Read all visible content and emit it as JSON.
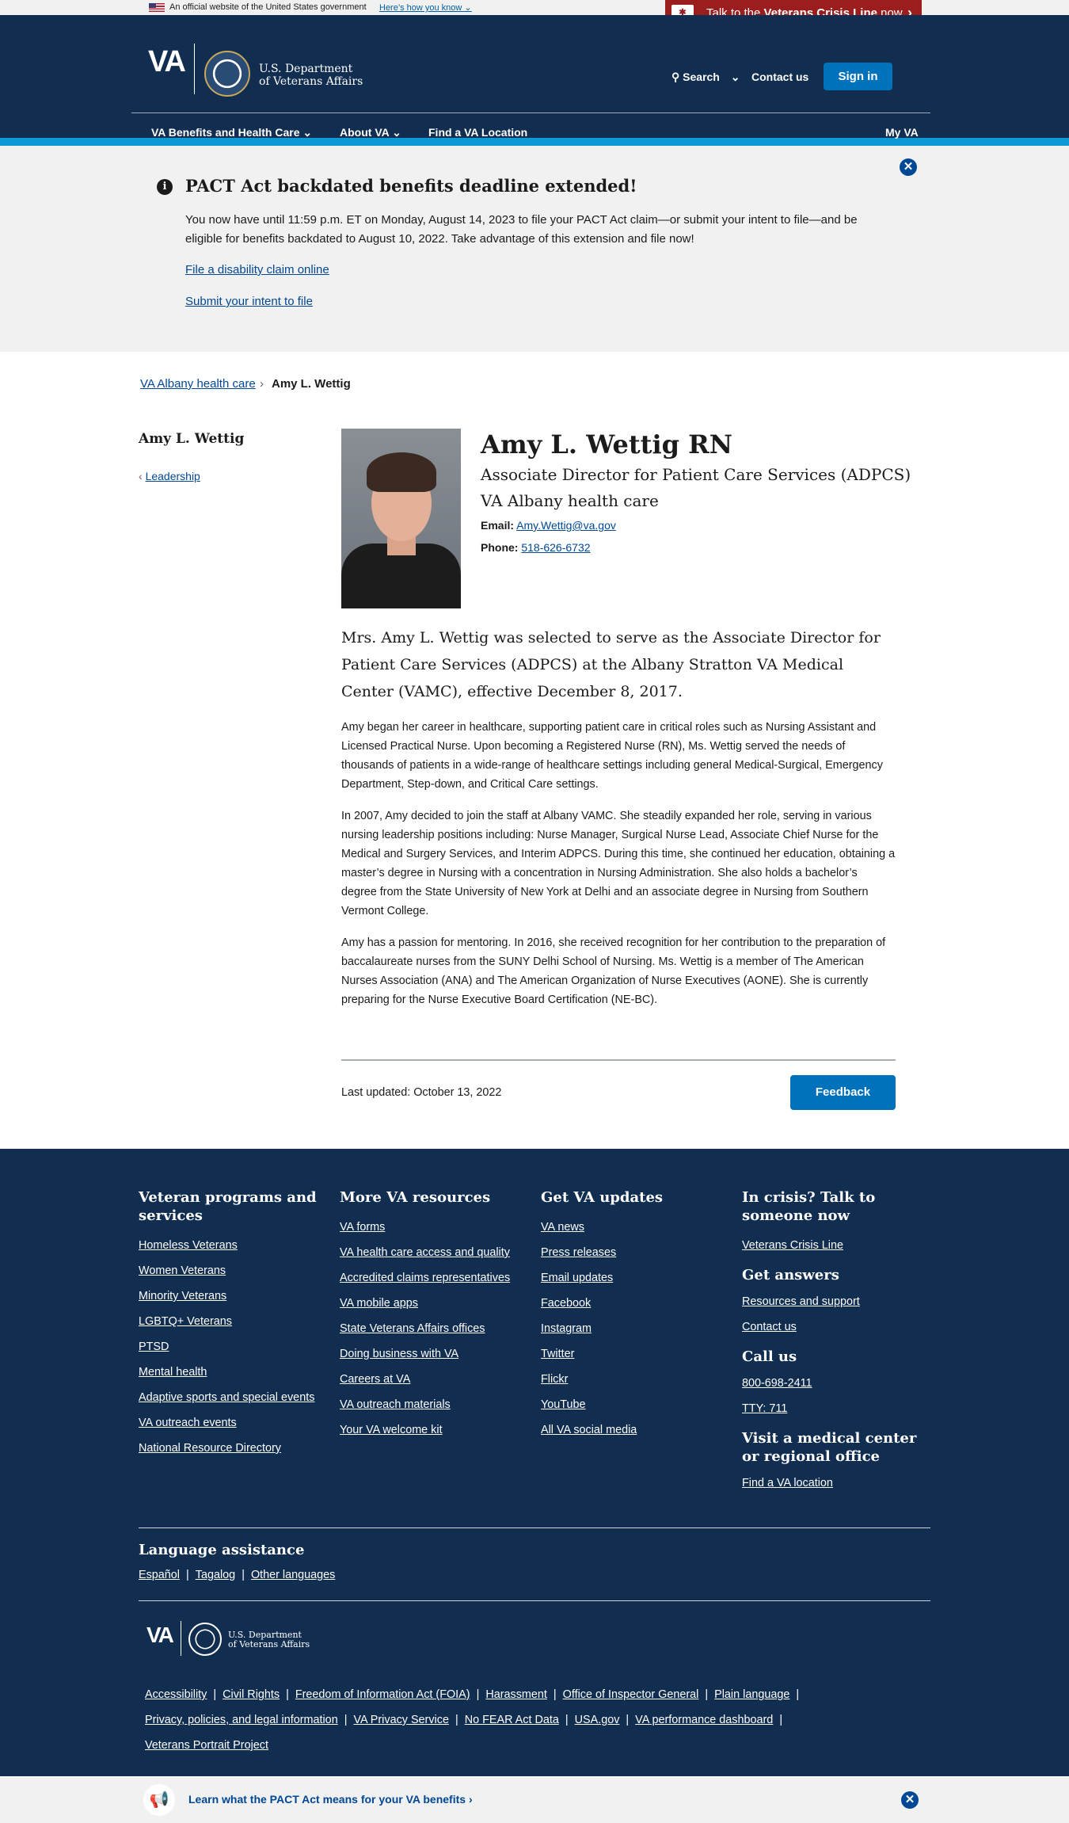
{
  "official_banner": {
    "text": "An official website of the United States government",
    "how_link": "Here’s how you know"
  },
  "crisis_line": {
    "prefix": "Talk to the ",
    "bold": "Veterans Crisis Line",
    "suffix": " now"
  },
  "header": {
    "logo": "VA",
    "dept_line1": "U.S. Department",
    "dept_line2": "of Veterans Affairs",
    "search": "Search",
    "contact": "Contact us",
    "sign_in": "Sign in",
    "nav": [
      "VA Benefits and Health Care",
      "About VA",
      "Find a VA Location"
    ],
    "my_va": "My VA"
  },
  "alert": {
    "title": "PACT Act backdated benefits deadline extended!",
    "body": "You now have until 11:59 p.m. ET on Monday, August 14, 2023 to file your PACT Act claim—or submit your intent to file—and be eligible for benefits backdated to August 10, 2022. Take advantage of this extension and file now!",
    "link1": "File a disability claim online",
    "link2": "Submit your intent to file"
  },
  "breadcrumb": {
    "parent": "VA Albany health care",
    "current": "Amy L. Wettig"
  },
  "sidebar": {
    "title": "Amy L. Wettig",
    "link": "Leadership"
  },
  "profile": {
    "name": "Amy L. Wettig RN",
    "role": "Associate Director for Patient Care Services (ADPCS)",
    "facility": "VA Albany health care",
    "email_label": "Email:",
    "email": "Amy.Wettig@va.gov",
    "phone_label": "Phone:",
    "phone": "518-626-6732"
  },
  "bio": {
    "lead": "Mrs. Amy L. Wettig was selected to serve as the Associate Director for Patient Care Services (ADPCS) at the Albany Stratton VA Medical Center (VAMC), effective December 8, 2017.",
    "p1": "Amy began her career in healthcare, supporting patient care in critical roles such as Nursing Assistant and Licensed Practical Nurse. Upon becoming a Registered Nurse (RN),  Ms. Wettig served the needs of thousands of patients in a wide-range of healthcare settings including general Medical-Surgical, Emergency Department, Step-down, and Critical Care settings.",
    "p2": "In 2007, Amy decided to join the staff at Albany VAMC. She steadily expanded her role, serving in various nursing leadership positions including: Nurse Manager, Surgical Nurse Lead, Associate Chief Nurse for the Medical and Surgery Services, and Interim ADPCS. During this time, she continued her education, obtaining a master’s degree in Nursing with a concentration in Nursing Administration. She also holds a bachelor’s degree from the State University of New York at Delhi and an associate degree in Nursing from Southern Vermont College.",
    "p3": "Amy has a passion for mentoring. In 2016, she received recognition for her contribution to the preparation of baccalaureate nurses from the SUNY Delhi School of Nursing. Ms. Wettig is a member of The American Nurses Association (ANA) and The American Organization of Nurse Executives (AONE). She is currently preparing for the Nurse Executive Board Certification (NE-BC)."
  },
  "last_updated": "Last updated: October 13, 2022",
  "feedback": "Feedback",
  "footer": {
    "col1": {
      "title": "Veteran programs and services",
      "links": [
        "Homeless Veterans",
        "Women Veterans",
        "Minority Veterans",
        "LGBTQ+ Veterans",
        "PTSD",
        "Mental health",
        "Adaptive sports and special events",
        "VA outreach events",
        "National Resource Directory"
      ]
    },
    "col2": {
      "title": "More VA resources",
      "links": [
        "VA forms",
        "VA health care access and quality",
        "Accredited claims representatives",
        "VA mobile apps",
        "State Veterans Affairs offices",
        "Doing business with VA",
        "Careers at VA",
        "VA outreach materials",
        "Your VA welcome kit"
      ]
    },
    "col3": {
      "title": "Get VA updates",
      "links": [
        "VA news",
        "Press releases",
        "Email updates",
        "Facebook",
        "Instagram",
        "Twitter",
        "Flickr",
        "YouTube",
        "All VA social media"
      ]
    },
    "col4": {
      "crisis_title": "In crisis? Talk to someone now",
      "crisis_link": "Veterans Crisis Line",
      "answers_title": "Get answers",
      "answers_links": [
        "Resources and support",
        "Contact us"
      ],
      "call_title": "Call us",
      "call_links": [
        "800-698-2411",
        "TTY: 711"
      ],
      "visit_title": "Visit a medical center or regional office",
      "visit_link": "Find a VA location"
    },
    "language": {
      "title": "Language assistance",
      "links": [
        "Español",
        "Tagalog",
        "Other languages"
      ]
    },
    "logo": "VA",
    "dept_line1": "U.S. Department",
    "dept_line2": "of Veterans Affairs",
    "legal_row1": [
      "Accessibility",
      "Civil Rights",
      "Freedom of Information Act (FOIA)",
      "Harassment",
      "Office of Inspector General",
      "Plain language"
    ],
    "legal_row2": [
      "Privacy, policies, and legal information",
      "VA Privacy Service",
      "No FEAR Act Data",
      "USA.gov",
      "VA performance dashboard"
    ],
    "legal_row3": [
      "Veterans Portrait Project"
    ]
  },
  "promo": {
    "text": "Learn what the PACT Act means for your VA benefits"
  },
  "colors": {
    "navy": "#112e51",
    "primary_blue": "#0071bb",
    "crisis_red": "#9c1d1d",
    "stripe": "#0f9ad6"
  }
}
